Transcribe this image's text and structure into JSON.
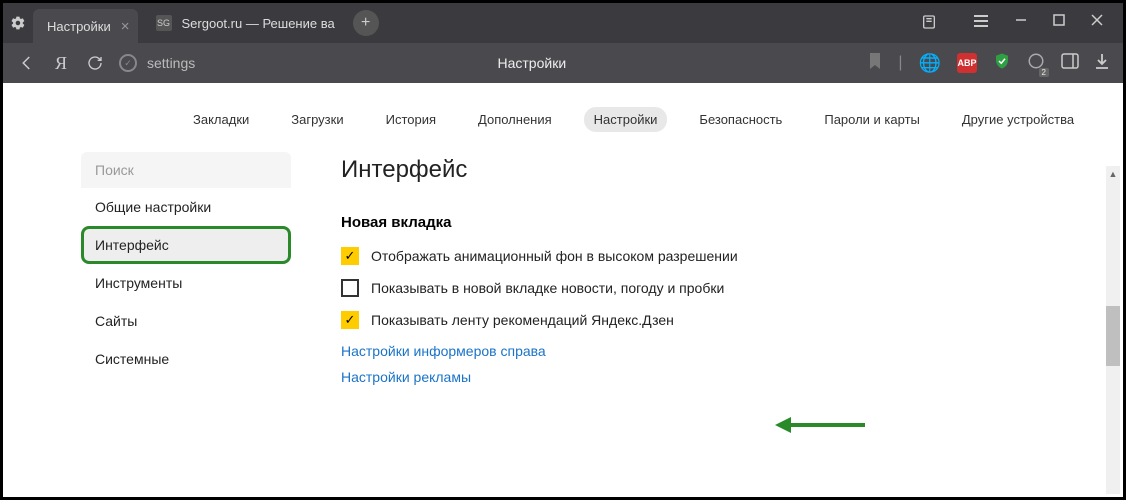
{
  "tabs": {
    "active": "Настройки",
    "second": "Sergoot.ru — Решение ва"
  },
  "addr": {
    "text": "settings",
    "title": "Настройки"
  },
  "ext": {
    "abp": "ABP",
    "badge": "2"
  },
  "topnav": [
    "Закладки",
    "Загрузки",
    "История",
    "Дополнения",
    "Настройки",
    "Безопасность",
    "Пароли и карты",
    "Другие устройства"
  ],
  "topnav_selected": 4,
  "sidebar": {
    "search": "Поиск",
    "items": [
      "Общие настройки",
      "Интерфейс",
      "Инструменты",
      "Сайты",
      "Системные"
    ],
    "active": 1
  },
  "panel": {
    "heading": "Интерфейс",
    "section": "Новая вкладка",
    "opts": [
      {
        "checked": true,
        "label": "Отображать анимационный фон в высоком разрешении"
      },
      {
        "checked": false,
        "label": "Показывать в новой вкладке новости, погоду и пробки"
      },
      {
        "checked": true,
        "label": "Показывать ленту рекомендаций Яндекс.Дзен"
      }
    ],
    "links": [
      "Настройки информеров справа",
      "Настройки рекламы"
    ]
  }
}
